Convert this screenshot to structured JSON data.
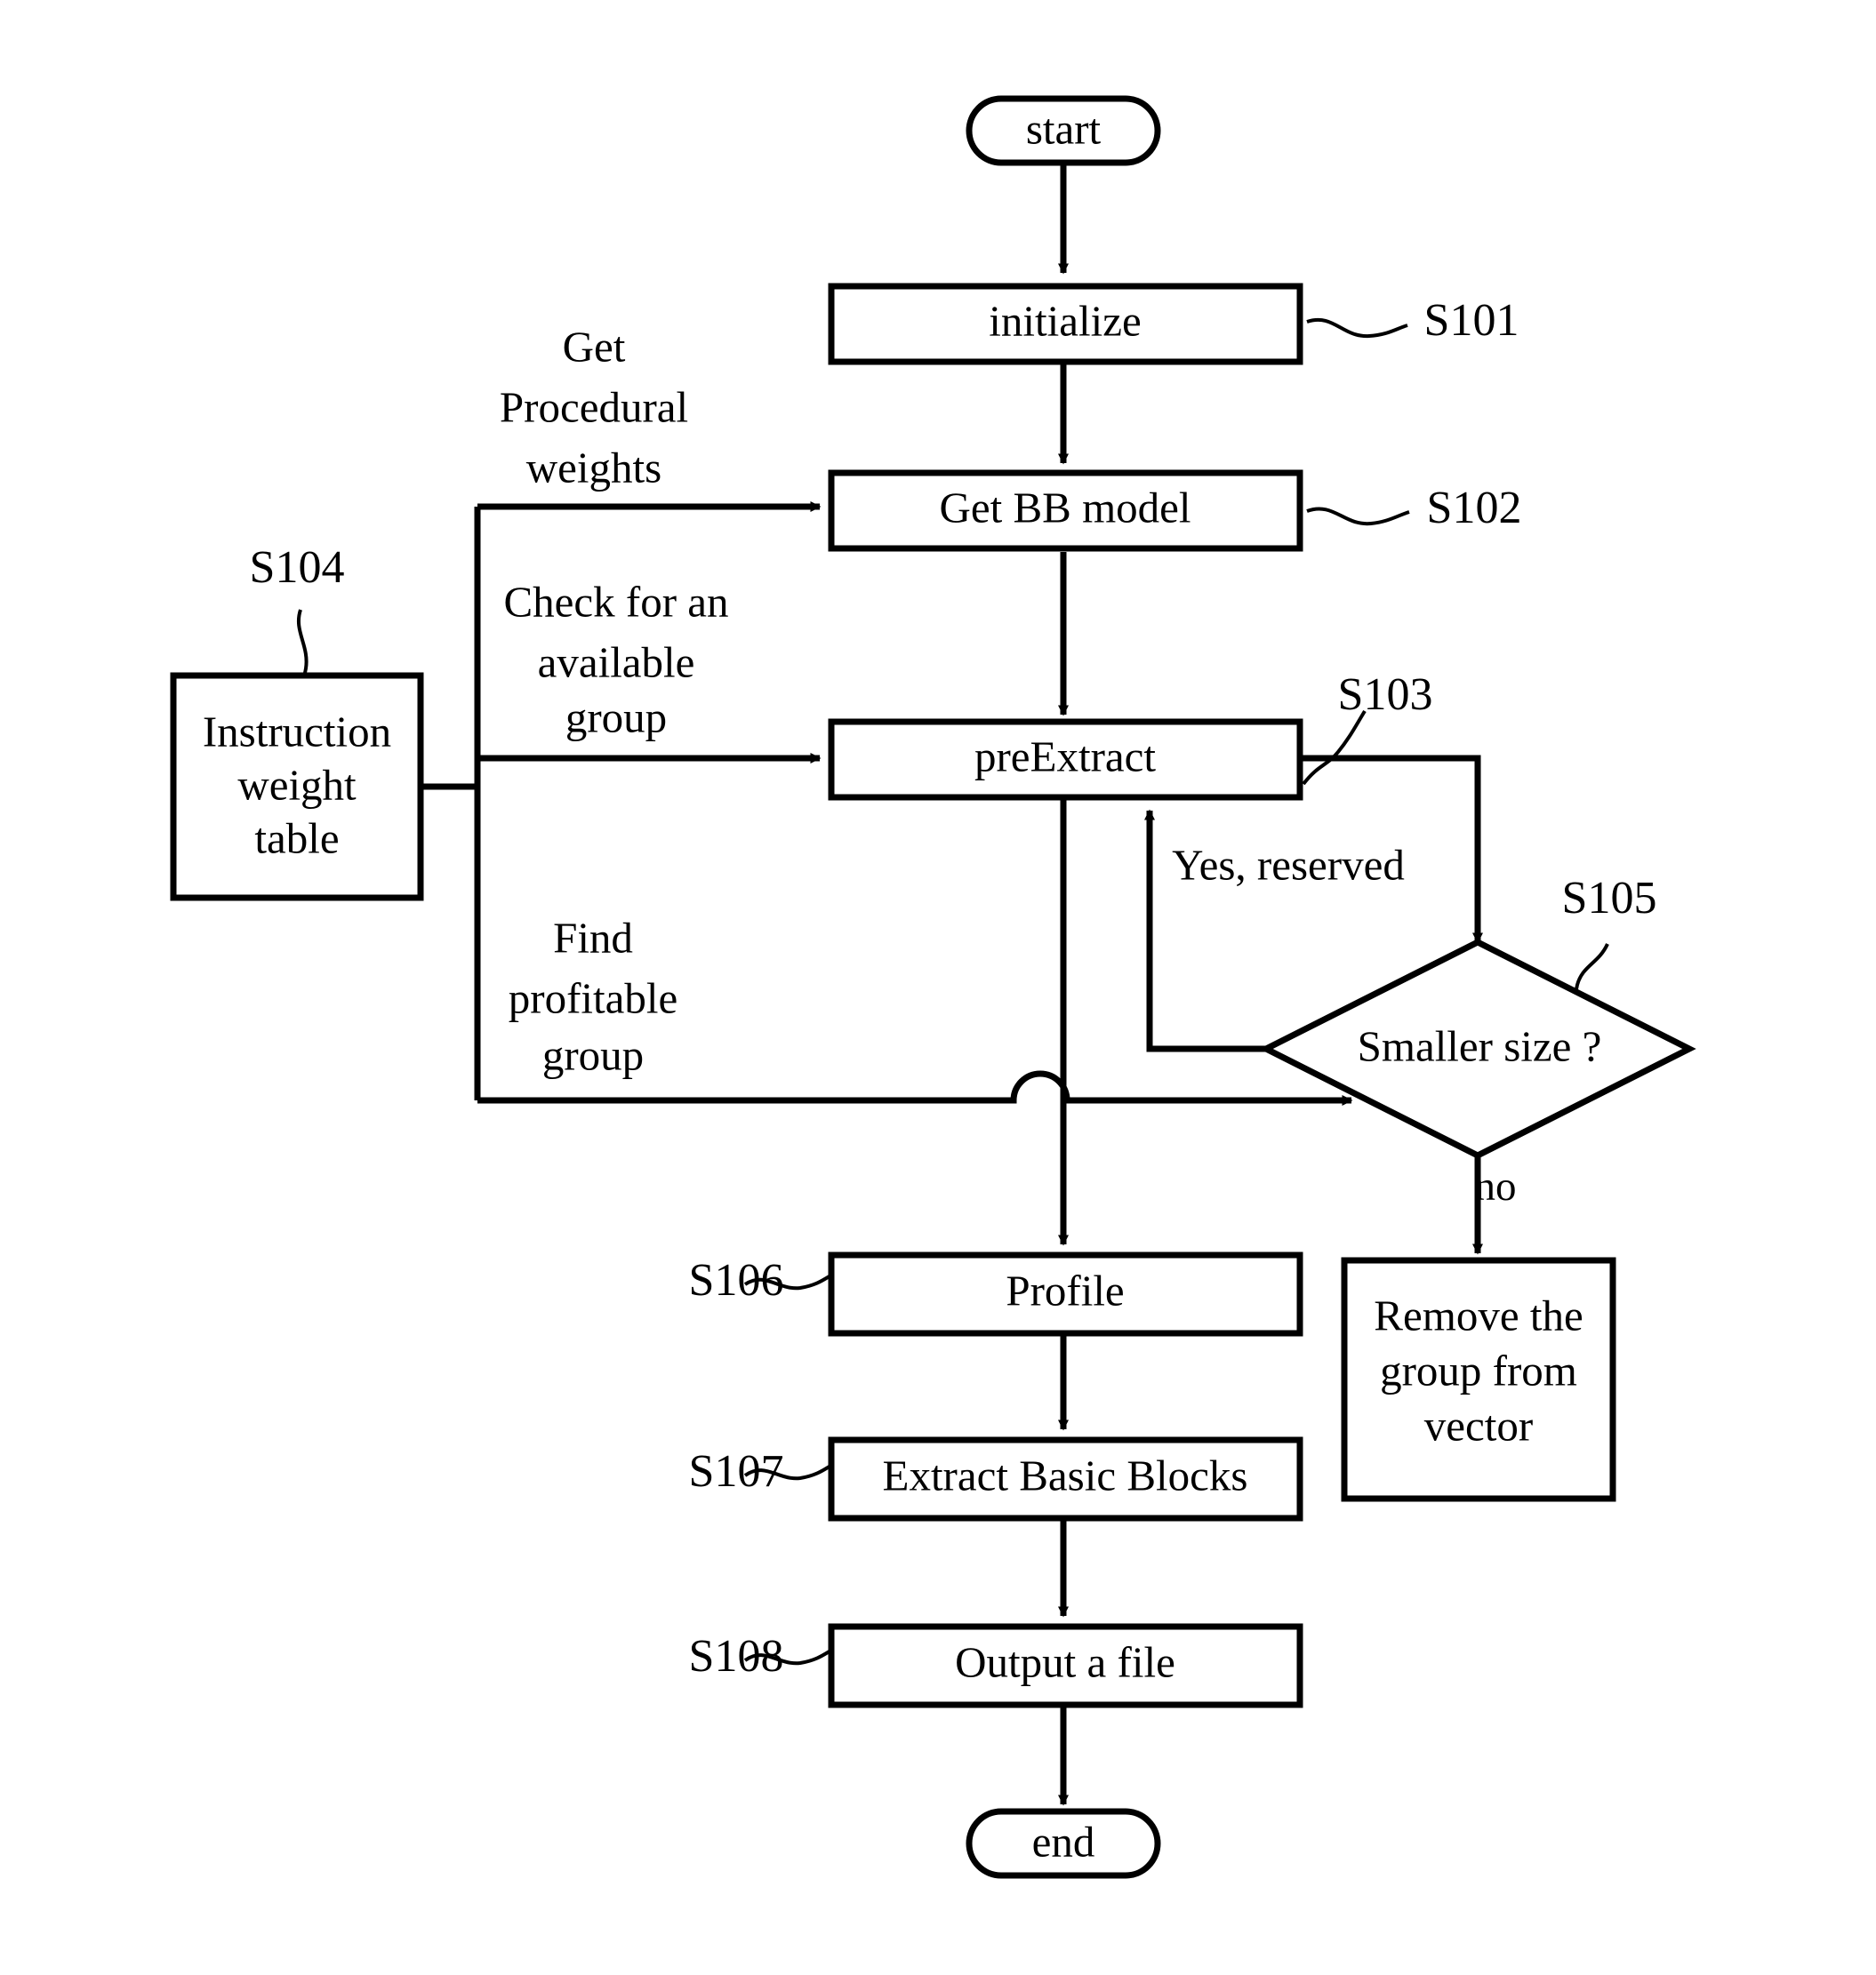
{
  "diagram": {
    "title": "Flowchart of basic block extraction process",
    "stroke_color": "#000000",
    "background_color": "#ffffff",
    "nodes": {
      "start": {
        "label": "start",
        "shape": "terminator"
      },
      "initialize": {
        "label": "initialize",
        "shape": "process",
        "ref": "S101"
      },
      "get_bb_model": {
        "label": "Get BB model",
        "shape": "process",
        "ref": "S102"
      },
      "pre_extract": {
        "label": "preExtract",
        "shape": "process",
        "ref": "S103"
      },
      "instruction_weight_table": {
        "label_line1": "Instruction",
        "label_line2": "weight",
        "label_line3": "table",
        "shape": "data-store",
        "ref": "S104"
      },
      "smaller_size": {
        "label": "Smaller size ?",
        "shape": "decision",
        "ref": "S105"
      },
      "remove_group": {
        "label_line1": "Remove the",
        "label_line2": "group from",
        "label_line3": "vector",
        "shape": "process"
      },
      "profile": {
        "label": "Profile",
        "shape": "process",
        "ref": "S106"
      },
      "extract_basic_blocks": {
        "label": "Extract Basic Blocks",
        "shape": "process",
        "ref": "S107"
      },
      "output_a_file": {
        "label": "Output a file",
        "shape": "process",
        "ref": "S108"
      },
      "end": {
        "label": "end",
        "shape": "terminator"
      }
    },
    "edge_labels": {
      "get_procedural_weights": {
        "line1": "Get",
        "line2": "Procedural",
        "line3": "weights"
      },
      "check_available_group": {
        "line1": "Check for an",
        "line2": "available",
        "line3": "group"
      },
      "find_profitable_group": {
        "line1": "Find",
        "line2": "profitable",
        "line3": "group"
      },
      "yes_reserved": {
        "text": "Yes, reserved"
      },
      "no": {
        "text": "no"
      }
    },
    "reference_numerals": {
      "s101": "S101",
      "s102": "S102",
      "s103": "S103",
      "s104": "S104",
      "s105": "S105",
      "s106": "S106",
      "s107": "S107",
      "s108": "S108"
    }
  }
}
